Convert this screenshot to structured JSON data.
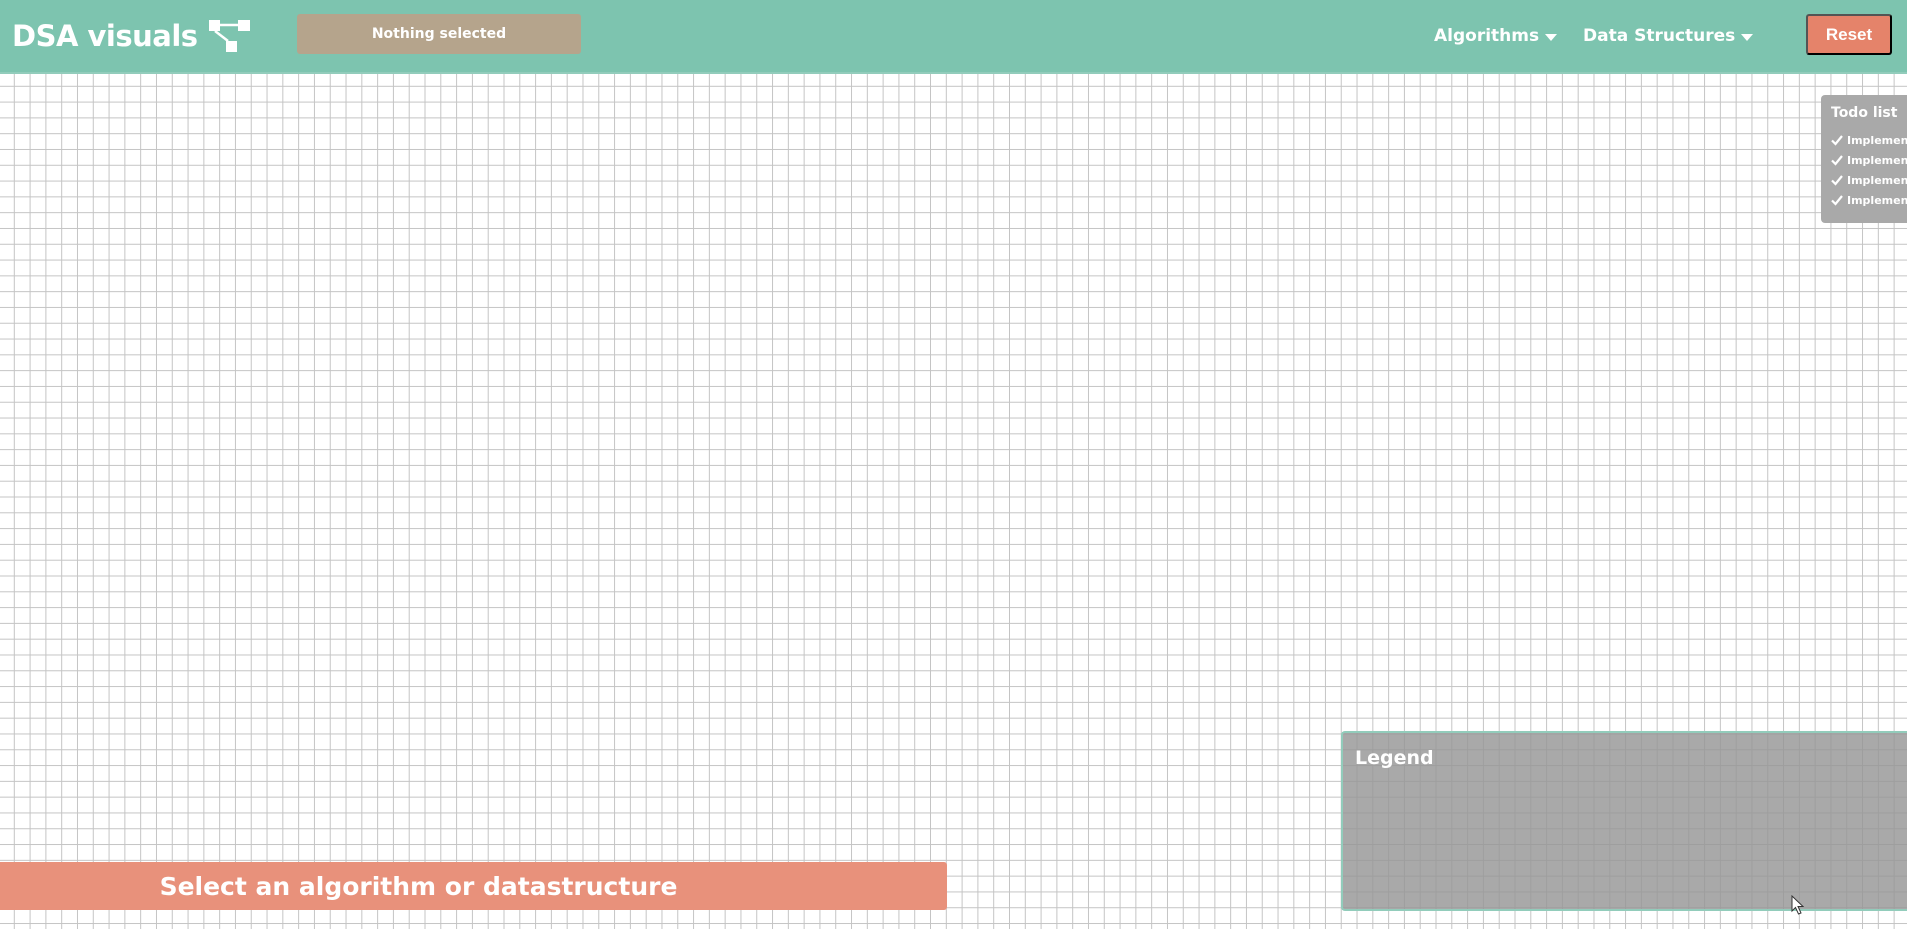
{
  "navbar": {
    "brand_title": "DSA visuals",
    "brand_icon": "tree-structure-icon",
    "selection_status": "Nothing selected",
    "menus": [
      {
        "label": "Algorithms",
        "icon": "caret-down-icon"
      },
      {
        "label": "Data Structures",
        "icon": "caret-down-icon"
      }
    ],
    "reset_label": "Reset"
  },
  "todo": {
    "title": "Todo list",
    "items": [
      "Implemen...",
      "Implemen...",
      "Implemen...",
      "Implemen..."
    ]
  },
  "legend": {
    "title": "Legend"
  },
  "prompt": {
    "message": "Select an algorithm or datastructure"
  },
  "colors": {
    "navbar": "#7dc4af",
    "selection_box": "#b5a48c",
    "reset_button": "#e5836a",
    "prompt_banner": "#e8917b",
    "panel_gray": "#a9a9a9",
    "grid_line": "#c4c4c4"
  }
}
